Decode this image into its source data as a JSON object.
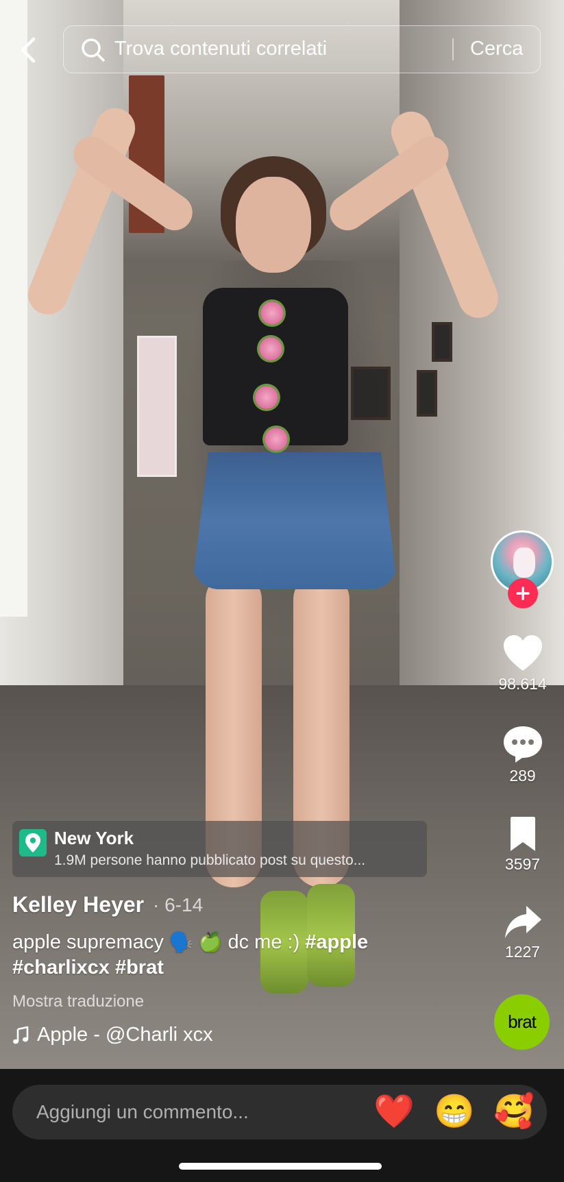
{
  "search": {
    "placeholder": "Trova contenuti correlati",
    "submit_label": "Cerca"
  },
  "actions": {
    "likes": "98.614",
    "comments": "289",
    "saves": "3597",
    "shares": "1227"
  },
  "music_disc": {
    "label": "brat",
    "color": "#8ace00"
  },
  "location": {
    "name": "New York",
    "subtitle": "1.9M persone hanno pubblicato post su questo..."
  },
  "post": {
    "author": "Kelley Heyer",
    "date": "· 6-14",
    "caption_text": "apple supremacy",
    "caption_emoji": "🗣️ 🍏",
    "caption_tail": "dc me :)",
    "hashtags": [
      "#apple",
      "#charlixcx",
      "#brat"
    ],
    "translate_label": "Mostra traduzione",
    "music": "Apple - @Charli xcx"
  },
  "comment": {
    "placeholder": "Aggiungi un commento...",
    "quick_emojis": [
      "❤️",
      "😁",
      "🥰"
    ]
  },
  "colors": {
    "follow": "#fe2c55",
    "location_pin": "#1fba8a"
  }
}
